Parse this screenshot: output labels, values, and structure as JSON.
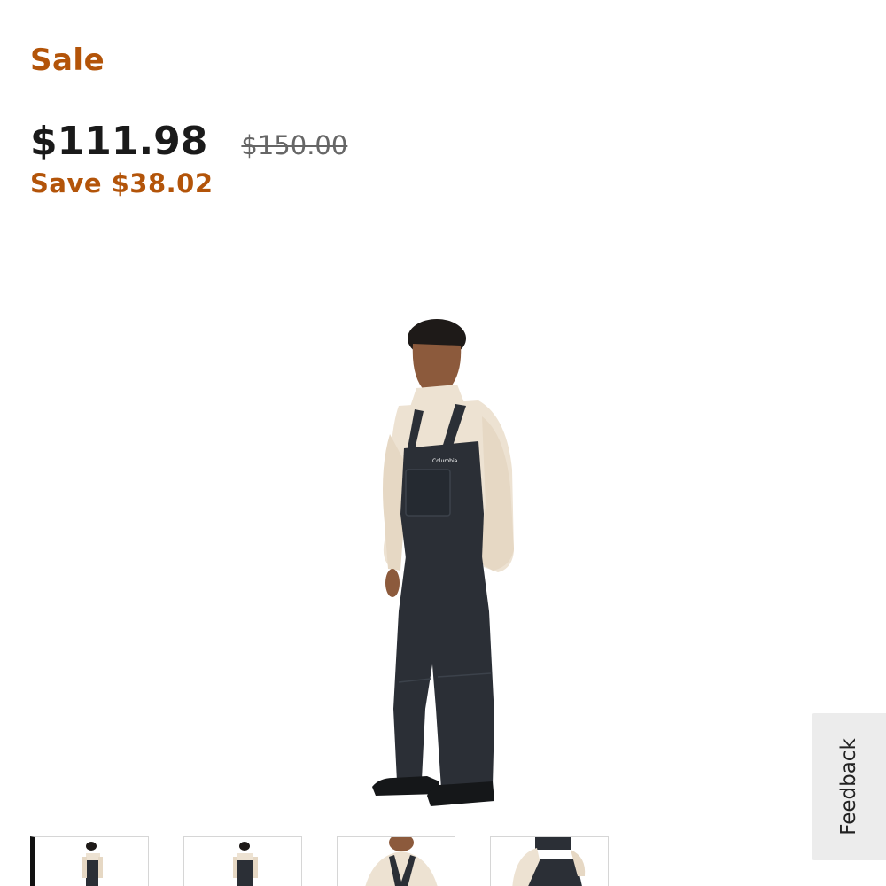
{
  "product": {
    "sale_label": "Sale",
    "current_price": "$111.98",
    "original_price": "$150.00",
    "savings": "Save $38.02",
    "image_brand_text": "Columbia"
  },
  "feedback": {
    "label": "Feedback"
  },
  "gallery": {
    "thumbnail_count": 4,
    "active_index": 0
  },
  "colors": {
    "accent": "#b35409",
    "price": "#1a1a1a",
    "bib": "#2b2f36",
    "fleece": "#ede2d2"
  }
}
